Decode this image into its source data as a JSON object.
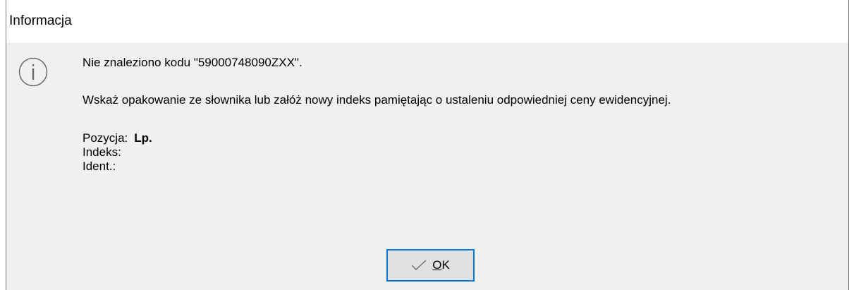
{
  "dialog": {
    "title": "Informacja",
    "icon": "information-icon",
    "message_line1": "Nie znaleziono kodu \"59000748090ZXX\".",
    "message_line2": "Wskaż opakowanie ze słownika lub załóż nowy indeks pamiętając o ustaleniu odpowiedniej ceny ewidencyjnej.",
    "details": {
      "pozycja_label": "Pozycja:",
      "pozycja_value": "Lp.",
      "indeks_label": "Indeks:",
      "ident_label": "Ident.:"
    },
    "ok_button": {
      "icon": "check-icon",
      "label_first": "O",
      "label_rest": "K"
    }
  },
  "colors": {
    "dialog_bg": "#f0f0f0",
    "titlebar_bg": "#ffffff",
    "button_border": "#0078d7",
    "button_bg": "#e1e1e1"
  }
}
